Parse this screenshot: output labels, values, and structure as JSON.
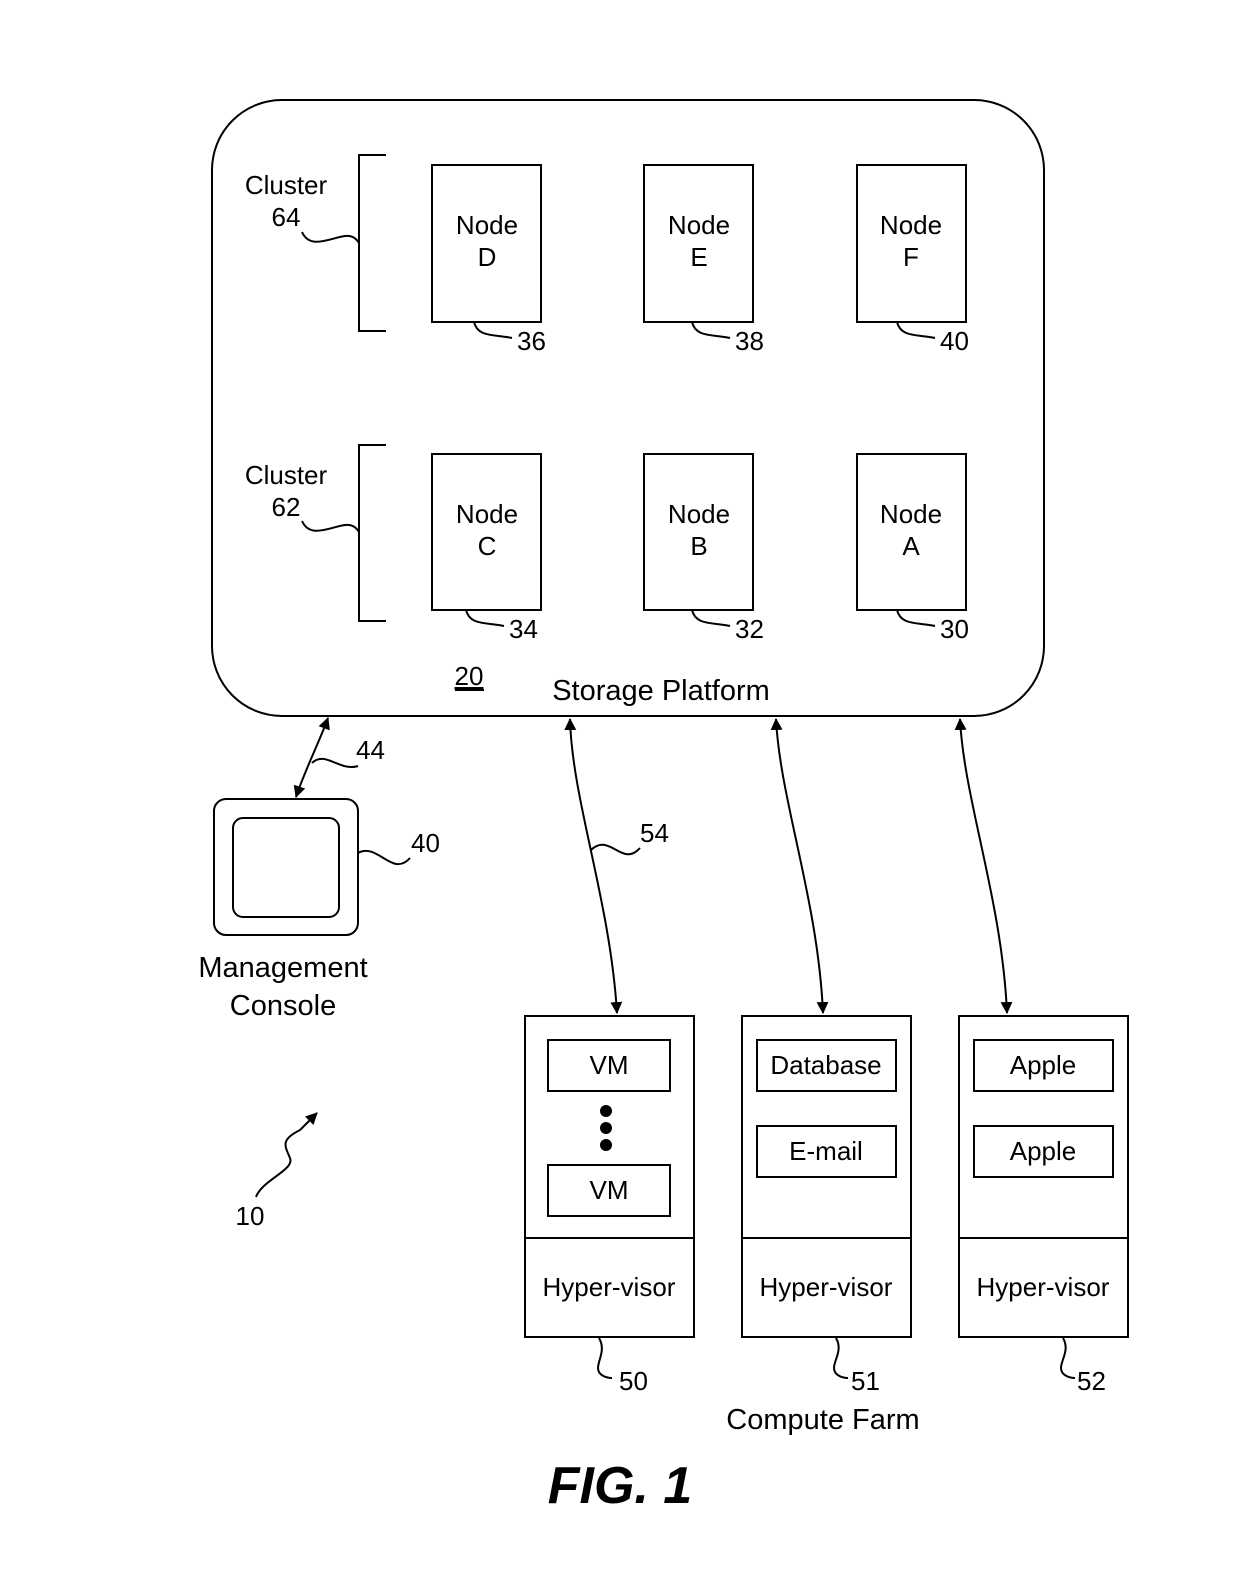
{
  "figure": {
    "caption": "FIG. 1",
    "system_ref": "10"
  },
  "storage_platform": {
    "label": "Storage Platform",
    "ref": "20",
    "clusters": [
      {
        "label": "Cluster",
        "ref": "64",
        "nodes": [
          {
            "label_line1": "Node",
            "label_line2": "D",
            "ref": "36"
          },
          {
            "label_line1": "Node",
            "label_line2": "E",
            "ref": "38"
          },
          {
            "label_line1": "Node",
            "label_line2": "F",
            "ref": "40"
          }
        ]
      },
      {
        "label": "Cluster",
        "ref": "62",
        "nodes": [
          {
            "label_line1": "Node",
            "label_line2": "C",
            "ref": "34"
          },
          {
            "label_line1": "Node",
            "label_line2": "B",
            "ref": "32"
          },
          {
            "label_line1": "Node",
            "label_line2": "A",
            "ref": "30"
          }
        ]
      }
    ]
  },
  "management_console": {
    "label_line1": "Management",
    "label_line2": "Console",
    "ref": "40",
    "link_ref": "44"
  },
  "compute_farm": {
    "label": "Compute Farm",
    "link_ref": "54",
    "servers": [
      {
        "ref": "50",
        "apps": [
          "VM",
          "VM"
        ],
        "has_ellipsis": true,
        "hypervisor": "Hyper-visor"
      },
      {
        "ref": "51",
        "apps": [
          "Database",
          "E-mail"
        ],
        "has_ellipsis": false,
        "hypervisor": "Hyper-visor"
      },
      {
        "ref": "52",
        "apps": [
          "Apple",
          "Apple"
        ],
        "has_ellipsis": false,
        "hypervisor": "Hyper-visor"
      }
    ]
  }
}
